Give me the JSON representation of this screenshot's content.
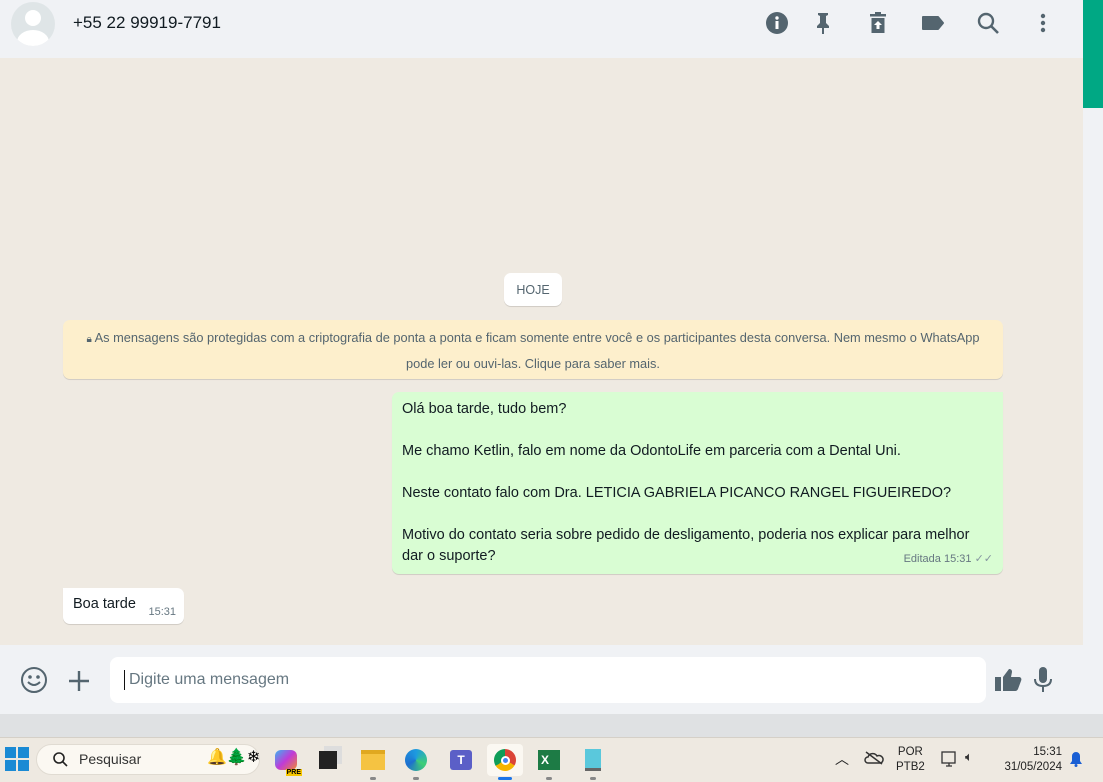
{
  "header": {
    "contact": "+55 22 99919-7791",
    "icons": [
      "info-icon",
      "pin-icon",
      "delete-icon",
      "label-icon",
      "search-icon",
      "menu-icon"
    ]
  },
  "chat": {
    "date_badge": "HOJE",
    "encryption_notice": "As mensagens são protegidas com a criptografia de ponta a ponta e ficam somente entre você e os participantes desta conversa. Nem mesmo o WhatsApp pode ler ou ouvi-las. Clique para saber mais.",
    "messages": [
      {
        "direction": "out",
        "paragraphs": [
          "Olá boa tarde, tudo bem?",
          "Me chamo Ketlin, falo em nome da OdontoLife em parceria com a Dental Uni.",
          "Neste contato falo com Dra. LETICIA GABRIELA PICANCO RANGEL FIGUEIREDO?",
          "Motivo do contato seria sobre pedido de desligamento, poderia nos explicar para melhor dar o suporte?"
        ],
        "edited": "Editada",
        "time": "15:31"
      },
      {
        "direction": "in",
        "text": "Boa tarde",
        "time": "15:31"
      }
    ]
  },
  "composer": {
    "placeholder": "Digite uma mensagem"
  },
  "taskbar": {
    "search": "Pesquisar",
    "lang": "POR",
    "layout": "PTB2",
    "time": "15:31",
    "date": "31/05/2024",
    "copilot_badge": "PRE"
  },
  "colors": {
    "accent": "#00a884",
    "outgoing": "#d9fdd3",
    "notice": "#fdefcc"
  }
}
